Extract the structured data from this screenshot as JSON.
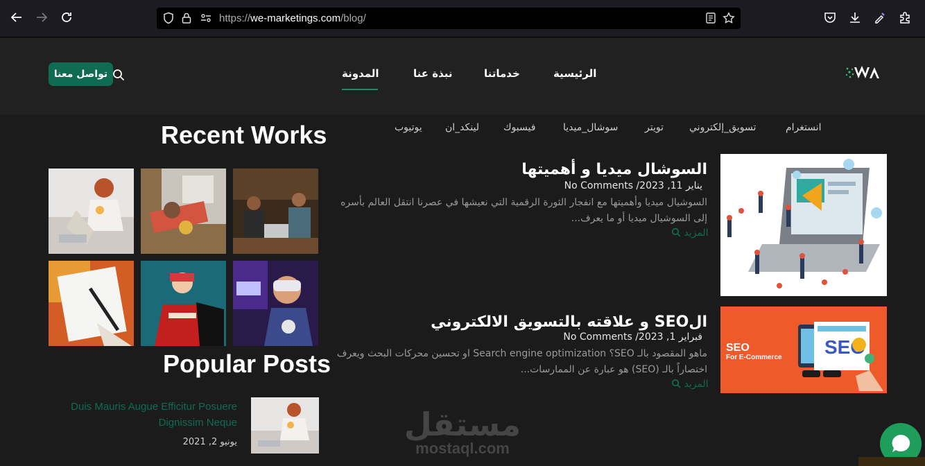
{
  "browser": {
    "url_scheme": "https://",
    "url_host": "we-marketings.com",
    "url_path": "/blog/"
  },
  "header": {
    "menu": [
      {
        "label": "الرئيسية"
      },
      {
        "label": "خدماتنا"
      },
      {
        "label": "نبذة عنا"
      },
      {
        "label": "المدونة"
      }
    ],
    "contact_label": "تواصل معنا",
    "accent_color": "#0f6b52"
  },
  "tags": [
    "انستغرام",
    "تسويق_إلكتروني",
    "تويتر",
    "سوشال_ميديا",
    "فيسبوك",
    "لينكد_ان",
    "يوتيوب"
  ],
  "sidebar": {
    "recent_works_title": "Recent Works",
    "popular_posts_title": "Popular Posts",
    "popular": [
      {
        "title": "Duis Mauris Augue Efficitur Posuere Dignissim Neque",
        "date": "يونيو 2, 2021"
      }
    ]
  },
  "posts": [
    {
      "title": "السوشال ميديا و أهميتها",
      "date": "يناير 11, 2023",
      "comments": "No Comments",
      "excerpt": "السوشيال ميديا وأهميتها مع انفجار الثورة الرقمية التي نعيشها في عصرنا انتقل العالم بأسره إلى السوشيال ميديا أو ما يعرف...",
      "more": "المزيد"
    },
    {
      "title": "الSEO و علاقته بالتسويق الالكتروني",
      "date": "فبراير 1, 2023",
      "comments": "No Comments",
      "excerpt": "ماهو المقصود بالـ SEO؟ Search engine optimization او تحسين محركات البحث ويعرف اختصاراً بالـ (SEO) هو عبارة عن الممارسات...",
      "more": "المزيد",
      "image_text_1": "SEO",
      "image_text_2": "For E-Commerce"
    }
  ],
  "watermark": {
    "arabic": "مستقل",
    "latin": "mostaql.com"
  }
}
